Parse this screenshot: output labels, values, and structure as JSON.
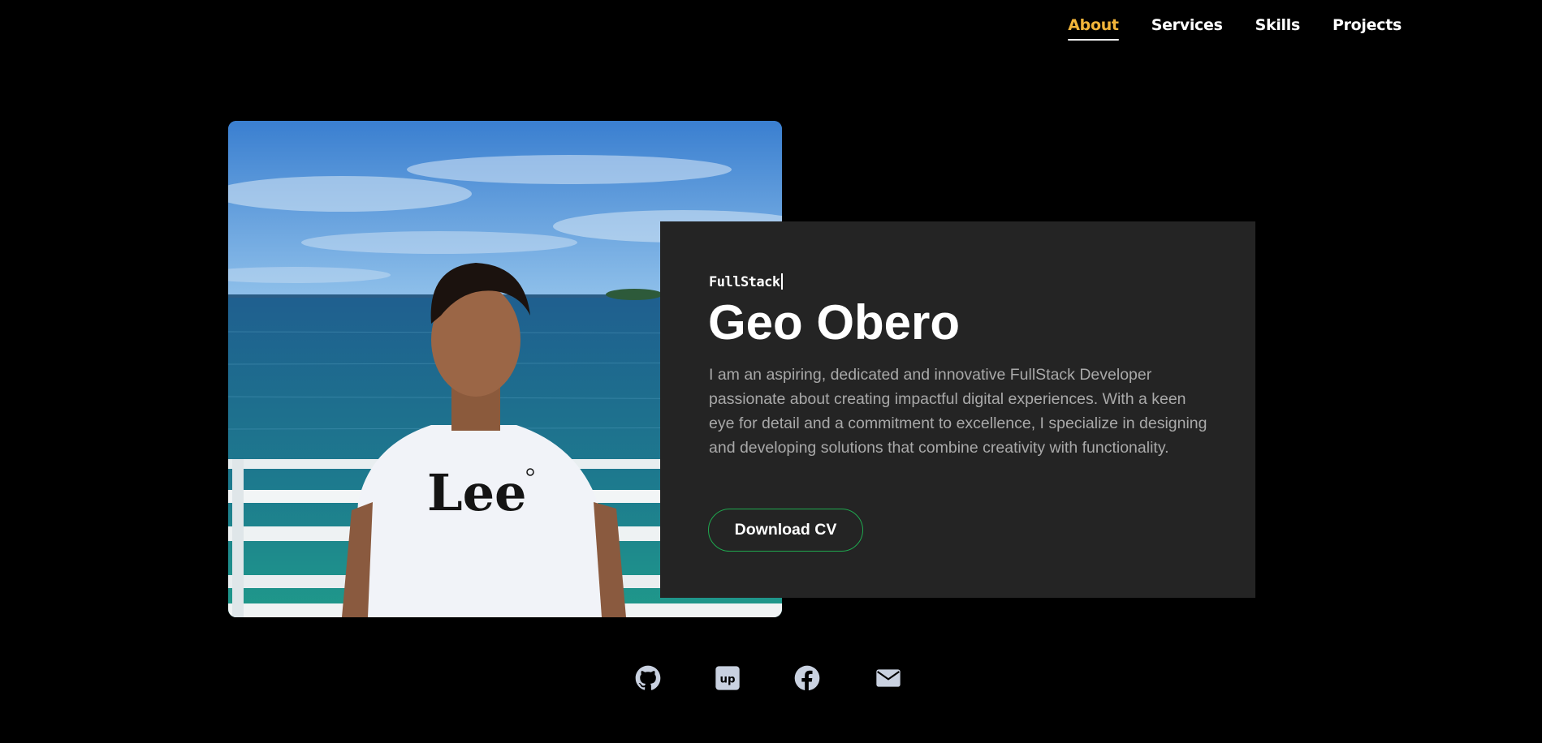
{
  "nav": {
    "items": [
      {
        "label": "About",
        "active": true
      },
      {
        "label": "Services",
        "active": false
      },
      {
        "label": "Skills",
        "active": false
      },
      {
        "label": "Projects",
        "active": false
      }
    ]
  },
  "hero": {
    "photo_alt": "Lee",
    "role": "FullStack",
    "name": "Geo Obero",
    "description": "I am an aspiring, dedicated and innovative FullStack Developer passionate about creating impactful digital experiences. With a keen eye for detail and a commitment to excellence, I specialize in designing and developing solutions that combine creativity with functionality.",
    "cv_button": "Download CV"
  },
  "social": [
    {
      "icon": "github-icon"
    },
    {
      "icon": "upwork-icon"
    },
    {
      "icon": "facebook-icon"
    },
    {
      "icon": "email-icon"
    }
  ],
  "colors": {
    "background": "#000000",
    "card": "#242424",
    "accent_active": "#f2b53a",
    "button_border": "#1fa84f",
    "text_muted": "#a9a9a9",
    "icon_color": "#c9d1e0"
  }
}
